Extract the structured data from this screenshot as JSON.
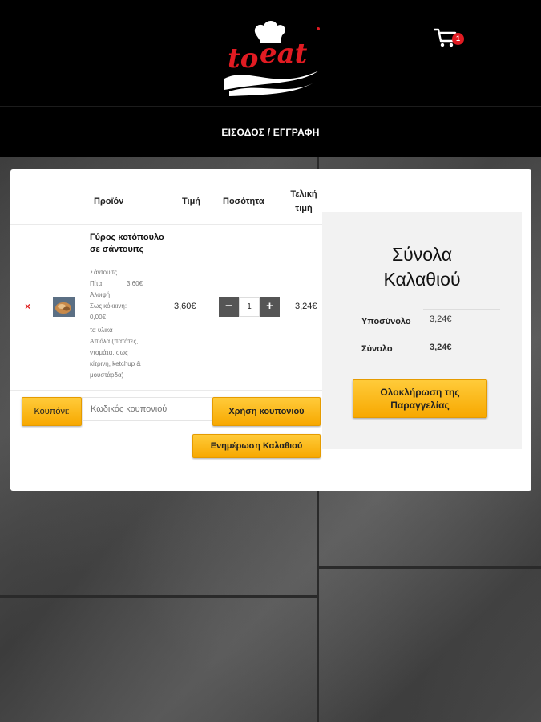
{
  "header": {
    "logo_text": "to eat",
    "cart_count": "1",
    "nav_link": "ΕΙΣΟΔΟΣ / ΕΓΓΡΑΦΗ"
  },
  "cart_table": {
    "headers": {
      "product": "Προϊόν",
      "price": "Τιμή",
      "quantity": "Ποσότητα",
      "total_line1": "Τελική",
      "total_line2": "τιμή"
    },
    "items": [
      {
        "remove": "×",
        "name": "Γύρος κοτόπουλο σε σάντουιτς",
        "category": "Σάντουιτς",
        "meta_bread_label": "Πίτα:",
        "meta_bread_value": "3,60€",
        "meta_sauce_line1": "Αλοιφή",
        "meta_sauce_line2": "Σως κόκκινη:",
        "meta_sauce_value": "0,00€",
        "meta_ing_line1": "τα υλικά",
        "meta_ing_line2": "Απ'όλα (πατάτες,",
        "meta_ing_line3": "ντομάτα, σως",
        "meta_ing_line4": "κίτρινη, ketchup &",
        "meta_ing_line5": "μουστάρδα)",
        "price": "3,60€",
        "quantity": "1",
        "total": "3,24€"
      }
    ],
    "qty_minus": "−",
    "qty_plus": "+"
  },
  "coupon": {
    "label": "Κουπόνι:",
    "placeholder": "Κωδικός κουπονιού",
    "apply_label": "Χρήση κουπονιού",
    "update_label": "Ενημέρωση Καλαθιού"
  },
  "totals": {
    "title_line1": "Σύνολα",
    "title_line2": "Καλαθιού",
    "subtotal_label": "Υποσύνολο",
    "subtotal_value": "3,24€",
    "total_label": "Σύνολο",
    "total_value": "3,24€",
    "checkout_line1": "Ολοκλήρωση της",
    "checkout_line2": "Παραγγελίας"
  },
  "colors": {
    "accent": "#f7a800",
    "remove": "#e02020",
    "brand_red": "#e11b22"
  }
}
